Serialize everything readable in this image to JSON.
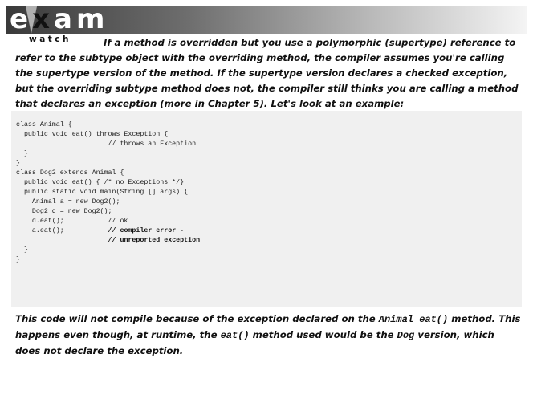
{
  "header": {
    "exam": "exam",
    "watch": "watch"
  },
  "intro_text": "If a method is overridden but you use a polymorphic (supertype) reference to refer to the subtype object with the overriding method, the compiler assumes you're calling the supertype version of the method. If the supertype version declares a checked exception, but the overriding subtype method does not, the compiler still thinks you are calling a method that declares an exception (more in Chapter 5). Let's look at an example:",
  "code_lines": [
    {
      "text": "class Animal {",
      "bold": ""
    },
    {
      "text": "  public void eat() throws Exception {",
      "bold": ""
    },
    {
      "text": "                       // throws an Exception",
      "bold": ""
    },
    {
      "text": "  }",
      "bold": ""
    },
    {
      "text": "}",
      "bold": ""
    },
    {
      "text": "class Dog2 extends Animal {",
      "bold": ""
    },
    {
      "text": "  public void eat() { /* no Exceptions */}",
      "bold": ""
    },
    {
      "text": "  public static void main(String [] args) {",
      "bold": ""
    },
    {
      "text": "    Animal a = new Dog2();",
      "bold": ""
    },
    {
      "text": "    Dog2 d = new Dog2();",
      "bold": ""
    },
    {
      "text": "    d.eat();           // ok",
      "bold": ""
    },
    {
      "text": "    a.eat();           ",
      "bold": "// compiler error -"
    },
    {
      "text": "                       ",
      "bold": "// unreported exception"
    },
    {
      "text": "  }",
      "bold": ""
    },
    {
      "text": "}",
      "bold": ""
    }
  ],
  "outro": {
    "p1": "This code will not compile because of the exception declared on the ",
    "c1": "Animal eat()",
    "p2": " method. This happens even though, at runtime, the ",
    "c2": "eat()",
    "p3": " method used would be the ",
    "c3": "Dog",
    "p4": " version, which does not declare the exception."
  }
}
